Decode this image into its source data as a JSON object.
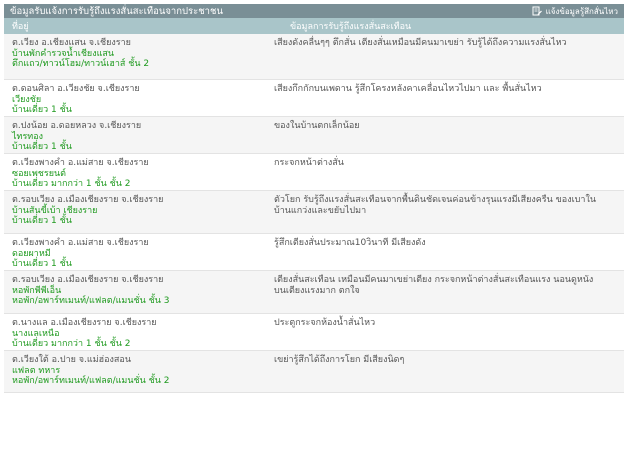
{
  "header": {
    "title": "ข้อมูลรับแจ้งการรับรู้ถึงแรงสั่นสะเทือนจากประชาชน",
    "report_label": "แจ้งข้อมูลรู้สึกสั่นไหว"
  },
  "columns": [
    "ที่อยู่",
    "ข้อมูลการรับรู้ถึงแรงสั่นสะเทือน"
  ],
  "rows": [
    {
      "location": "ต.เวียง อ.เชียงแสน จ.เชียงราย",
      "place": "บ้านพักคำรวจน้ำเชียงแสน",
      "building": "ตึกแถว/ทาวน์โฮม/ทาวน์เฮาส์ ชั้น 2",
      "report": "เสียงดังคลื่นๆๆ ตึกสั่น เตียงสั่นเหมือนมีคนมาเขย่า รับรู้ได้ถึงความแรงสั่นไหว"
    },
    {
      "location": "ต.ดอนศิลา อ.เวียงชัย จ.เชียงราย",
      "place": "เวียงชัย",
      "building": "บ้านเดี่ยว 1 ชั้น",
      "report": "เสียงกึกกักบนเพดาน รู้สึกโครงหลังคาเคลื่อนไหวไปมา และ พื้นสั่นไหว"
    },
    {
      "location": "ต.ปงน้อย อ.ดอยหลวง จ.เชียงราย",
      "place": "ไทรทอง",
      "building": "บ้านเดี่ยว 1 ชั้น",
      "report": "ของในบ้านตกเล็กน้อย"
    },
    {
      "location": "ต.เวียงพางคำ อ.แม่สาย จ.เชียงราย",
      "place": "ซอยเพชรยนต์",
      "building": "บ้านเดี่ยว มากกว่า 1 ชั้น ชั้น 2",
      "report": "กระจกหน้าต่างสั่น"
    },
    {
      "location": "ต.รอบเวียง อ.เมืองเชียงราย จ.เชียงราย",
      "place": "บ้านสันขี้เบ้า เชียงราย",
      "building": "บ้านเดี่ยว 1 ชั้น",
      "report": "ตัวโยก รับรู้ถึงแรงสั่นสะเทือนจากพื้นดินชัดเจนค่อนข้างรุนแรงมีเสียงครืน ของเบาในบ้านแกว่งและขยับไปมา"
    },
    {
      "location": "ต.เวียงพางคำ อ.แม่สาย จ.เชียงราย",
      "place": "ดอยผาหมี",
      "building": "บ้านเดี่ยว 1 ชั้น",
      "report": "รู้สึกเตียงสั่นประมาณ10วินาที มีเสียงดัง"
    },
    {
      "location": "ต.รอบเวียง อ.เมืองเชียงราย จ.เชียงราย",
      "place": "หอพักพีพีเอ็น",
      "building": "หอพัก/อพาร์ทเมนท์/แฟลต/แมนชั่น ชั้น 3",
      "report": "เตียงสั่นสะเทือน เหมือนมีคนมาเขย่าเตียง กระจกหน้าต่างสั่นสะเทือนแรง นอนดูหนังบนเตียงแรงมาก ตกใจ"
    },
    {
      "location": "ต.นางแล อ.เมืองเชียงราย จ.เชียงราย",
      "place": "นางแลเหนือ",
      "building": "บ้านเดี่ยว มากกว่า 1 ชั้น ชั้น 2",
      "report": "ประตูกระจกห้องน้ำสั่นไหว"
    },
    {
      "location": "ต.เวียงใต้ อ.ปาย จ.แม่ฮ่องสอน",
      "place": "แฟลต ทหาร",
      "building": "หอพัก/อพาร์ทเมนท์/แฟลต/แมนชั่น ชั้น 2",
      "report": "เขย่ารู้สึกได้ถึงการโยก มีเสียงนิดๆ"
    }
  ],
  "colors": {
    "title_bg": "#7a8f96",
    "header_bg": "#a9c5c9",
    "accent_green": "#1f9a1f"
  },
  "icons": {
    "report": "document-edit-icon"
  }
}
